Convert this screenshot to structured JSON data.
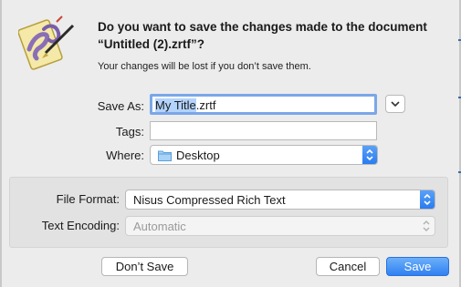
{
  "dialog": {
    "title": "Do you want to save the changes made to the document “Untitled (2).zrtf”?",
    "subtitle": "Your changes will be lost if you don’t save them.",
    "app_icon": "nisus-writer-pen-icon"
  },
  "save_as": {
    "label": "Save As:",
    "value_selected": "My Title",
    "value_extension": ".zrtf"
  },
  "tags": {
    "label": "Tags:",
    "value": ""
  },
  "where": {
    "label": "Where:",
    "value": "Desktop",
    "icon": "folder-icon"
  },
  "options": {
    "file_format_label": "File Format:",
    "file_format_value": "Nisus Compressed Rich Text",
    "text_encoding_label": "Text Encoding:",
    "text_encoding_value": "Automatic"
  },
  "buttons": {
    "dont_save": "Don’t Save",
    "cancel": "Cancel",
    "save": "Save"
  },
  "colors": {
    "accent": "#2f80f2",
    "selection": "#b3d3fb",
    "focus_ring": "#7aa7e8",
    "dialog_bg": "#ececec"
  }
}
